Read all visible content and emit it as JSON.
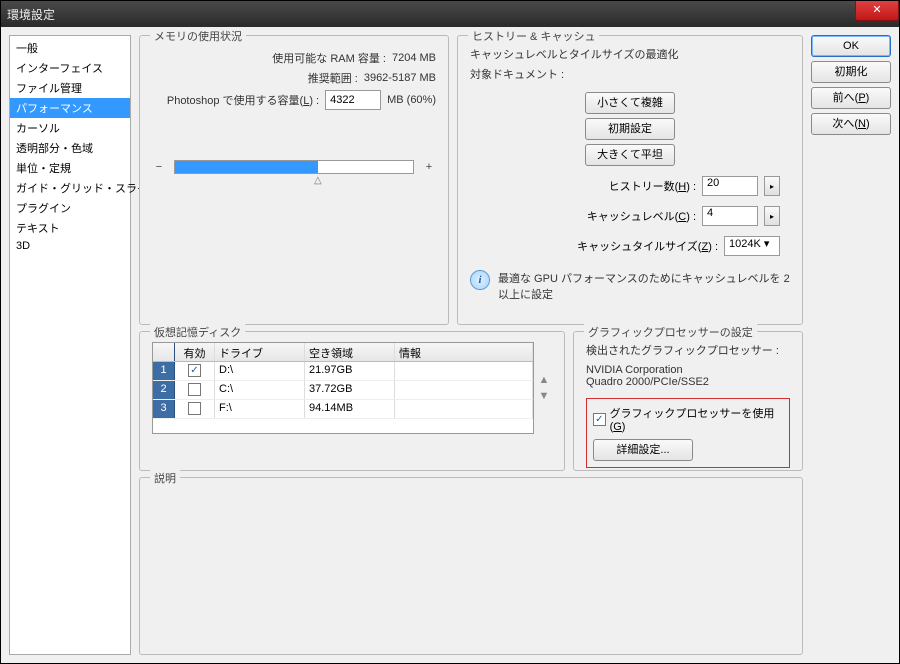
{
  "window": {
    "title": "環境設定"
  },
  "sidebar": {
    "items": [
      {
        "label": "一般"
      },
      {
        "label": "インターフェイス"
      },
      {
        "label": "ファイル管理"
      },
      {
        "label": "パフォーマンス",
        "selected": true
      },
      {
        "label": "カーソル"
      },
      {
        "label": "透明部分・色域"
      },
      {
        "label": "単位・定規"
      },
      {
        "label": "ガイド・グリッド・スライス"
      },
      {
        "label": "プラグイン"
      },
      {
        "label": "テキスト"
      },
      {
        "label": "3D"
      }
    ]
  },
  "memory": {
    "legend": "メモリの使用状況",
    "available_label": "使用可能な RAM 容量 :",
    "available_value": "7204 MB",
    "range_label": "推奨範囲 :",
    "range_value": "3962-5187 MB",
    "use_label_pre": "Photoshop で使用する容量(",
    "use_key": "L",
    "use_label_post": ") :",
    "use_value": "4322",
    "use_unit": "MB (60%)",
    "minus": "−",
    "plus": "+",
    "marker": "△"
  },
  "history": {
    "legend": "ヒストリー & キャッシュ",
    "sub1": "キャッシュレベルとタイルサイズの最適化",
    "sub2": "対象ドキュメント :",
    "btn_small": "小さくて複雑",
    "btn_default": "初期設定",
    "btn_big": "大きくて平坦",
    "hist_label_pre": "ヒストリー数(",
    "hist_key": "H",
    "hist_label_post": ") :",
    "hist_value": "20",
    "cache_label_pre": "キャッシュレベル(",
    "cache_key": "C",
    "cache_label_post": ") :",
    "cache_value": "4",
    "tile_label_pre": "キャッシュタイルサイズ(",
    "tile_key": "Z",
    "tile_label_post": ") :",
    "tile_value": "1024K",
    "info": "最適な GPU パフォーマンスのためにキャッシュレベルを 2 以上に設定"
  },
  "scratch": {
    "legend": "仮想記憶ディスク",
    "headers": {
      "c1": "有効",
      "c2": "ドライブ",
      "c3": "空き領域",
      "c4": "情報"
    },
    "rows": [
      {
        "n": "1",
        "on": true,
        "drive": "D:\\",
        "free": "21.97GB",
        "info": ""
      },
      {
        "n": "2",
        "on": false,
        "drive": "C:\\",
        "free": "37.72GB",
        "info": ""
      },
      {
        "n": "3",
        "on": false,
        "drive": "F:\\",
        "free": "94.14MB",
        "info": ""
      }
    ]
  },
  "gpu": {
    "legend": "グラフィックプロセッサーの設定",
    "detected": "検出されたグラフィックプロセッサー :",
    "line1": "NVIDIA Corporation",
    "line2": "Quadro 2000/PCIe/SSE2",
    "use_label_pre": "グラフィックプロセッサーを使用(",
    "use_key": "G",
    "use_label_post": ")",
    "advanced": "詳細設定..."
  },
  "desc": {
    "legend": "説明"
  },
  "buttons": {
    "ok": "OK",
    "reset": "初期化",
    "prev_pre": "前へ(",
    "prev_key": "P",
    "prev_post": ")",
    "next_pre": "次へ(",
    "next_key": "N",
    "next_post": ")"
  },
  "glyphs": {
    "check": "✓",
    "up": "▲",
    "down": "▼",
    "spin": "▸",
    "dropdown": "▾"
  }
}
